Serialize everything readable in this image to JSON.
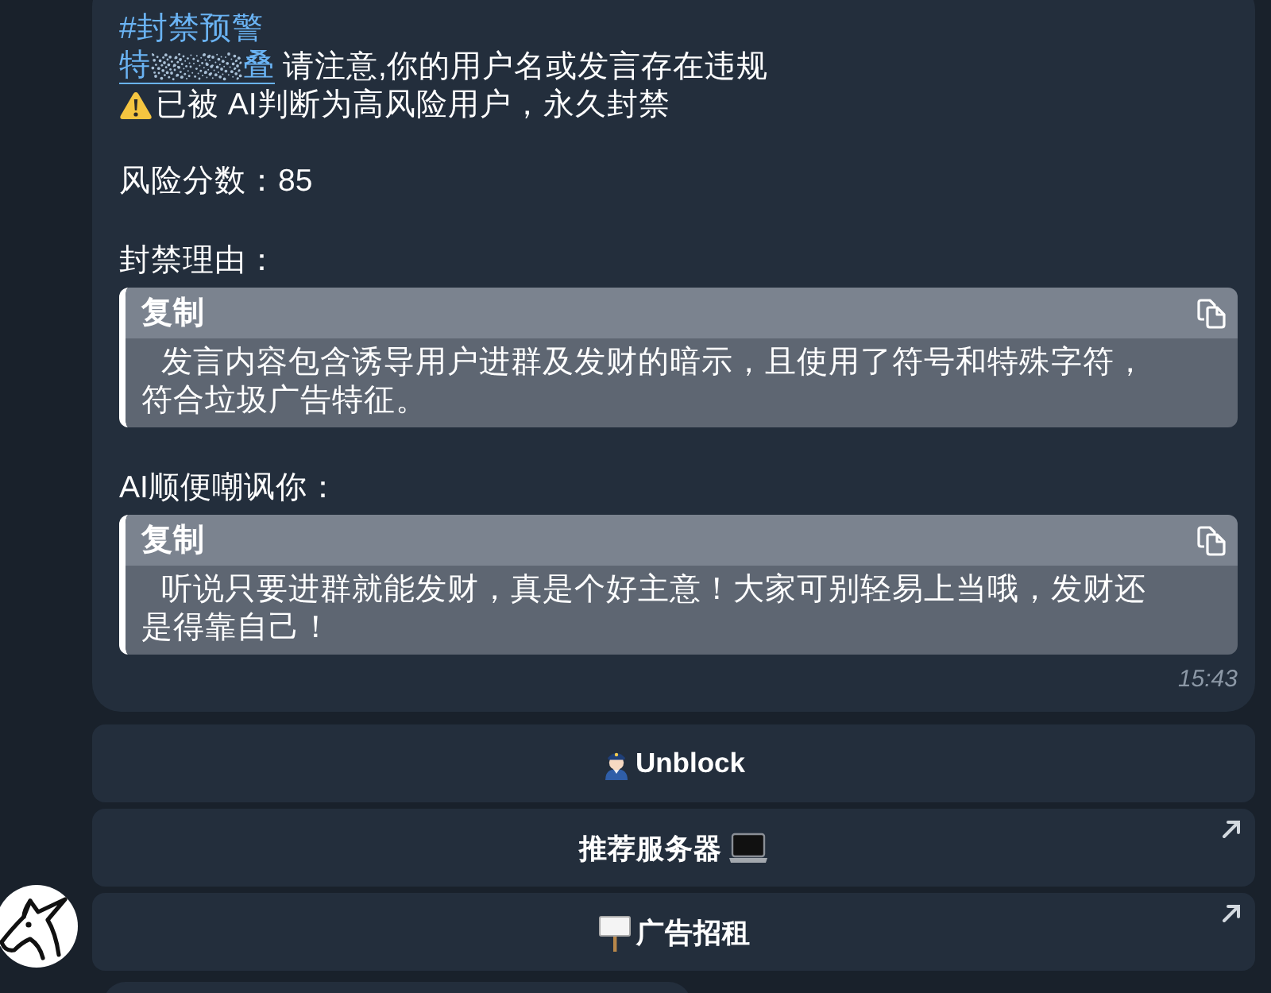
{
  "message": {
    "hashtag": "#封禁预警",
    "mention": {
      "visible_start": "特",
      "visible_end": "叠"
    },
    "notice": "请注意,你的用户名或发言存在违规",
    "warning": "已被 AI判断为高风险用户，永久封禁",
    "score": "风险分数：85",
    "sections": [
      {
        "label": "封禁理由：",
        "block_label": "复制",
        "text": "发言内容包含诱导用户进群及发财的暗示，且使用了符号和特殊字符，符合垃圾广告特征。"
      },
      {
        "label": "AI顺便嘲讽你：",
        "block_label": "复制",
        "text": "听说只要进群就能发财，真是个好主意！大家可别轻易上当哦，发财还是得靠自己！"
      }
    ],
    "time": "15:43"
  },
  "buttons": [
    {
      "label": "Unblock",
      "kind": "callback"
    },
    {
      "label": "推荐服务器",
      "kind": "url"
    },
    {
      "label": "广告招租",
      "kind": "url"
    }
  ]
}
